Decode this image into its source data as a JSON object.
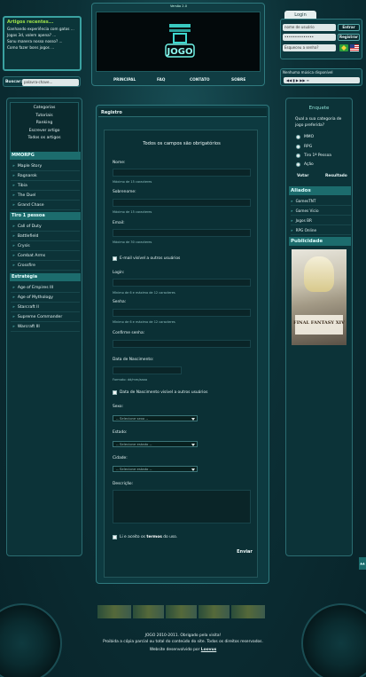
{
  "recent": {
    "title": "Artigos recentes...",
    "items": [
      "Ganhando experiência com gatos ...",
      "Jogos 3d, valem apena? ...",
      "Sonu manera nosso nosso? ...",
      "Como fazer bons jogos ..."
    ]
  },
  "search": {
    "label": "Buscar:",
    "placeholder": "palavra-chave..."
  },
  "header": {
    "version": "Versão 2.0",
    "logo_text": "JOGO",
    "nav": [
      "PRINCIPAL",
      "FAQ",
      "CONTATO",
      "SOBRE"
    ]
  },
  "login": {
    "tab": "Login",
    "user_placeholder": "nome de usuário",
    "pass_value": "••••••••••••••",
    "enter": "Entrar",
    "register": "Registrar",
    "forgot": "Esqueceu a senha?"
  },
  "music": {
    "label": "Nenhuma música disponível",
    "controls": "◀◀ ▮ ▶ ▶▶ ≡"
  },
  "sidebar": {
    "links": [
      "Categorias",
      "Tutoriais",
      "Ranking",
      "Escrever artigo",
      "Todos os artigos"
    ],
    "cat_mmorpg": "MMORPG",
    "mmorpg": [
      "Maple Story",
      "Ragnarok",
      "Tibia",
      "The Duel",
      "Grand Chase"
    ],
    "cat_tiro": "Tiro 1 pessoa",
    "tiro": [
      "Call of Duty",
      "Battlefield",
      "Crysis",
      "Combat Arms",
      "Crossfire"
    ],
    "cat_estrategia": "Estratégia",
    "estrategia": [
      "Age of Empires III",
      "Age of Mythology",
      "Starcraft II",
      "Supreme Commander",
      "Warcraft III"
    ]
  },
  "poll": {
    "title": "Enquete",
    "question": "Qual a sua categoria de jogo preferida?",
    "options": [
      "MMO",
      "RPG",
      "Tiro 1ª Pessoa",
      "Ação"
    ],
    "vote": "Votar",
    "results": "Resultado"
  },
  "allies": {
    "title": "Aliados",
    "items": [
      "GamesTNT",
      "Games Vicio",
      "Jogos BR",
      "RPG Online"
    ]
  },
  "ad": {
    "title": "Publicidade",
    "caption": "FINAL FANTASY XIV"
  },
  "register": {
    "title": "Registro",
    "required": "Todos os campos são obrigatórios",
    "name": "Nome:",
    "name_hint": "Máximo de 15 caracteres",
    "surname": "Sobrenome:",
    "surname_hint": "Máximo de 15 caracteres",
    "email": "Email:",
    "email_hint": "Máximo de 30 caracteres",
    "email_visible": "E-mail visível a outros usuários",
    "login": "Login:",
    "login_hint": "Mínimo de 6 e máximo de 12 caracteres",
    "password": "Senha:",
    "password_hint": "Mínimo de 6 e máximo de 12 caracteres",
    "confirm": "Confirme senha:",
    "birth": "Data de Nascimento:",
    "birth_hint": "Formato: dd/mm/aaaa",
    "birth_visible": "Data de Nascimento visível a outros usuários",
    "sex": "Sexo:",
    "sex_select": "-- Selecione sexo --",
    "state": "Estado:",
    "state_select": "-- Selecione estado --",
    "city": "Cidade:",
    "city_select": "-- Selecione estado --",
    "description": "Descrição:",
    "accept_pre": "Li e aceito os",
    "accept_terms": "termos",
    "accept_post": "do uso.",
    "send": "Enviar"
  },
  "footer": {
    "line1": "JOGO 2010-2011. Obrigado pela visita!",
    "line2": "Proibida a cópia parcial ou total do conteúdo do site. Todos os direitos reservados.",
    "line3": "Website desenvolvido por",
    "author": "Loovus"
  },
  "edge_label": "▲▲"
}
